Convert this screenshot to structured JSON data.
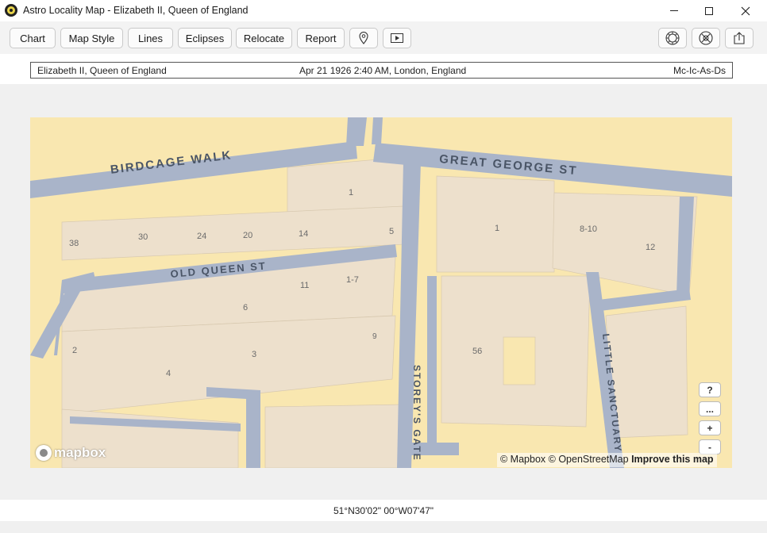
{
  "window": {
    "title": "Astro Locality Map - Elizabeth II, Queen of England"
  },
  "toolbar": {
    "buttons": [
      {
        "label": "Chart"
      },
      {
        "label": "Map Style"
      },
      {
        "label": "Lines"
      },
      {
        "label": "Eclipses"
      },
      {
        "label": "Relocate"
      },
      {
        "label": "Report"
      }
    ],
    "icon_buttons": [
      {
        "icon": "location-pin-icon"
      },
      {
        "icon": "play-icon"
      },
      {
        "icon": "zodiac-wheel-icon"
      },
      {
        "icon": "compass-globe-icon"
      },
      {
        "icon": "share-icon"
      }
    ]
  },
  "info": {
    "name": "Elizabeth II, Queen of England",
    "datetime_place": "Apr 21 1926 2:40 AM, London, England",
    "lines": "Mc-Ic-As-Ds"
  },
  "map": {
    "streets": {
      "birdcage_walk": "BIRDCAGE WALK",
      "great_george_st": "GREAT GEORGE ST",
      "old_queen_st": "OLD QUEEN ST",
      "storeys_gate": "STOREY'S GATE",
      "little_sanctuary": "LITTLE SANCTUARY"
    },
    "building_numbers": {
      "b1": "1",
      "b38": "38",
      "b30": "30",
      "b24": "24",
      "b20": "20",
      "b14": "14",
      "b5": "5",
      "b1b": "1",
      "b810": "8-10",
      "b12": "12",
      "b11": "11",
      "b17": "1-7",
      "b6": "6",
      "b2": "2",
      "b4": "4",
      "b3": "3",
      "b9": "9",
      "b56": "56"
    },
    "controls": {
      "help": "?",
      "more": "...",
      "zoom_in": "+",
      "zoom_out": "-"
    },
    "logo": "mapbox",
    "attribution": {
      "mapbox": "© Mapbox",
      "osm": "© OpenStreetMap",
      "improve": "Improve this map"
    }
  },
  "footer": {
    "coordinates": "51°N30'02\"  00°W07'47\""
  }
}
